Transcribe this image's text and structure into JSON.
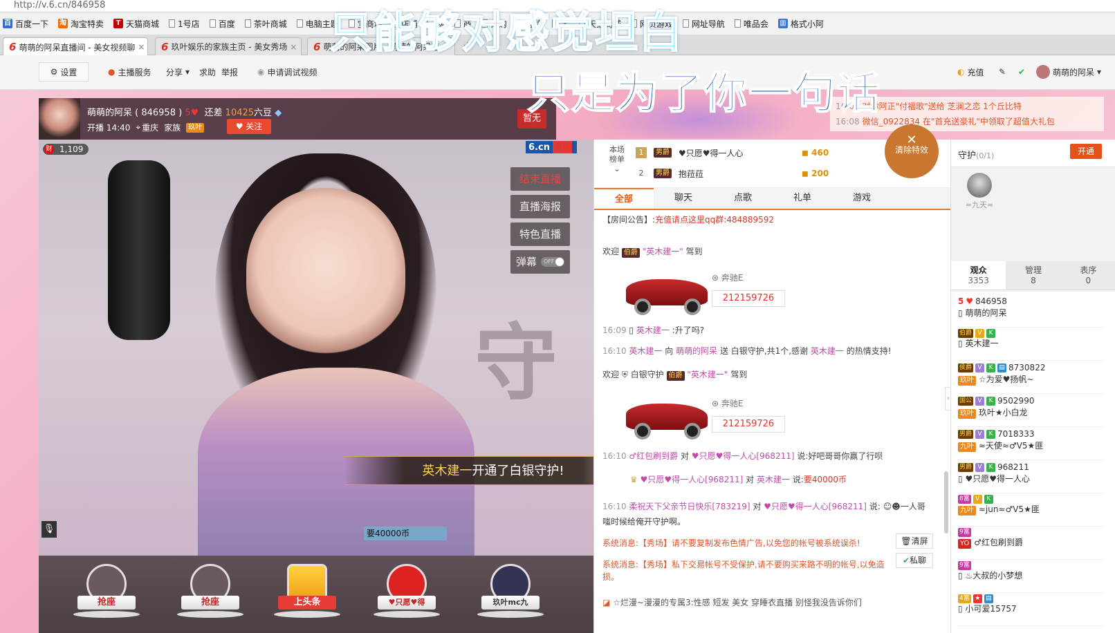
{
  "browser": {
    "url": "http://v.6.cn/846958",
    "bookmarks": [
      "百度一下",
      "淘宝特卖",
      "天猫商城",
      "1号店",
      "百度",
      "茶叶商城",
      "电脑主题",
      "宝商城",
      "店铺",
      "网",
      "商",
      "易购",
      "宝特",
      "宝",
      "天猫商城",
      "网页游戏",
      "网址导航",
      "唯品会",
      "格式小阿"
    ],
    "tabs": [
      {
        "label": "萌萌的阿呆直播间 - 美女视频聊"
      },
      {
        "label": "玖叶娱乐的家族主页 - 美女秀场"
      },
      {
        "label": "萌萌的阿呆图片 - 萌萌的阿呆直"
      }
    ],
    "newtab_label": "+"
  },
  "sitebar": {
    "settings": "设置",
    "host_service": "主播服务",
    "share": "分享",
    "help": "求助",
    "report": "举报",
    "apply_debug": "申请调试视频",
    "recharge": "充值",
    "username": "萌萌的阿呆"
  },
  "host": {
    "name": "萌萌的阿呆 ( 846958 )",
    "level": "5",
    "remaining_label": "还差",
    "remaining_value": "10425",
    "remaining_unit": "六豆",
    "start_time": "开播 14:40",
    "location": "重庆",
    "family_label": "家族",
    "family_badge": "玖叶",
    "follow_label": "关注",
    "banner": "暂无"
  },
  "video": {
    "view_count": "1,109",
    "view_icon": "财",
    "brand": "6.cn",
    "live_badge": "直播",
    "buttons": [
      "结束直播",
      "直播海报",
      "特色直播"
    ],
    "danmu_label": "弹幕",
    "danmu_state": "OFF",
    "watermark": "守",
    "notice_user": "英木建一",
    "notice_text": "开通了白银守护!",
    "tip_bubble": "要40000币"
  },
  "seats": [
    {
      "label": "抢座"
    },
    {
      "label": "抢座"
    },
    {
      "label": "上头条"
    },
    {
      "label": "♥只愿♥得"
    },
    {
      "label": "玖叶mc九"
    }
  ],
  "rank": {
    "title_l1": "本场",
    "title_l2": "榜单",
    "rows": [
      {
        "num": "1",
        "medal": "男爵",
        "name": "♥只愿♥得一人心",
        "coins": "460"
      },
      {
        "num": "2",
        "medal": "男爵",
        "name": "抱菈菈",
        "coins": "200"
      }
    ],
    "clear_fx": "清除特效",
    "car_count": "6"
  },
  "chat_tabs": [
    "全部",
    "聊天",
    "点歌",
    "礼单",
    "游戏"
  ],
  "chat": {
    "announcement_label": "【房间公告】:",
    "announcement": "充值请点这里qq群:484889592",
    "welcome1": {
      "prefix": "欢迎",
      "medal": "伯爵",
      "user": "\"英木建一\"",
      "suffix": "驾到"
    },
    "car1": {
      "name": "奔驰E",
      "number": "212159726"
    },
    "m1": {
      "time": "16:09",
      "user": "英木建一",
      "text": ":升了吗?"
    },
    "m2": {
      "time": "16:10",
      "user": "英木建一",
      "mid": "向",
      "target": "萌萌的阿呆",
      "text": "送 白银守护,共1个,感谢",
      "user2": "英木建一",
      "tail": "的热情支持!"
    },
    "welcome2": {
      "prefix": "欢迎",
      "role": "白银守护",
      "medal": "伯爵",
      "user": "\"英木建一\"",
      "suffix": "驾到"
    },
    "car2": {
      "name": "奔驰E",
      "number": "212159726"
    },
    "m3": {
      "time": "16:10",
      "user": "♂红包刷到爵",
      "mid": "对",
      "target": "♥只愿♥得一人心[968211]",
      "text": "说:好吧哥哥你赢了行呗"
    },
    "m4": {
      "user": "♥只愿♥得一人心[968211]",
      "mid": "对",
      "target": "英木建一",
      "text": "说:",
      "red": "要40000币"
    },
    "m5": {
      "time": "16:10",
      "user": "柔祝天下父亲节日快乐[783219]",
      "mid": "对",
      "target": "♥只愿♥得一人心[968211]",
      "text": "说:",
      "tail": "一人哥",
      "line2": "嗤时候给俺开守护啊。"
    },
    "sys1": "系统消息:【秀场】请不要复制发布色情广告,以免您的帐号被系统误杀!",
    "sys2_l1": "系统消息:【秀场】私下交易帐号不受保护,请不要购买来路不明的帐号,以免造",
    "sys2_l2": "损。",
    "bottom": "☆烂漫~漫漫的专属3:性感 短发 美女 穿睡衣直播 别怪我没告诉你们",
    "clear_btn": "清屏",
    "pm_btn": "私聊"
  },
  "guard": {
    "title": "守护",
    "count": "(0/1)",
    "open": "开通",
    "member": "≈九天≈"
  },
  "audience_tabs": [
    {
      "label": "观众",
      "count": "3353"
    },
    {
      "label": "管理",
      "count": "8"
    },
    {
      "label": "表序",
      "count": "0"
    }
  ],
  "audience": [
    {
      "badge": "5",
      "id": "846958",
      "name": "萌萌的阿呆"
    },
    {
      "badge": "伯爵",
      "id": "",
      "name": "英木建一"
    },
    {
      "badge": "侯爵",
      "id": "8730822",
      "name": "☆为爱♥扬帆~"
    },
    {
      "badge": "国公",
      "id": "9502990",
      "name": "玖叶★小白龙"
    },
    {
      "badge": "男爵",
      "id": "7018333",
      "name": "≈天使≈♂V5★匪"
    },
    {
      "badge": "男爵",
      "id": "968211",
      "name": "♥只愿♥得一人心"
    },
    {
      "badge": "8富",
      "id": "",
      "name": "≈jun≈♂V5★匪"
    },
    {
      "badge": "9富",
      "id": "",
      "name": "♂红包刷到爵"
    },
    {
      "badge": "9富",
      "id": "",
      "name": "♨大叔的小梦想"
    },
    {
      "badge": "4富",
      "id": "",
      "name": "小可爱15757"
    }
  ],
  "ticker": [
    {
      "time": "16:08",
      "text": "对你阿正\"付福歌\"送给 芝澜之恋 1个丘比特"
    },
    {
      "time": "16:08",
      "text": "微信_0922834 在\"首充送豪礼\"中领取了超值大礼包"
    }
  ],
  "overlay": {
    "lyric1": "只能够对感觉坦白",
    "lyric2": "只是为了你一句话"
  },
  "colors": {
    "accent": "#e57830",
    "brand_red": "#e0311d",
    "brand_blue": "#1b55a3"
  }
}
